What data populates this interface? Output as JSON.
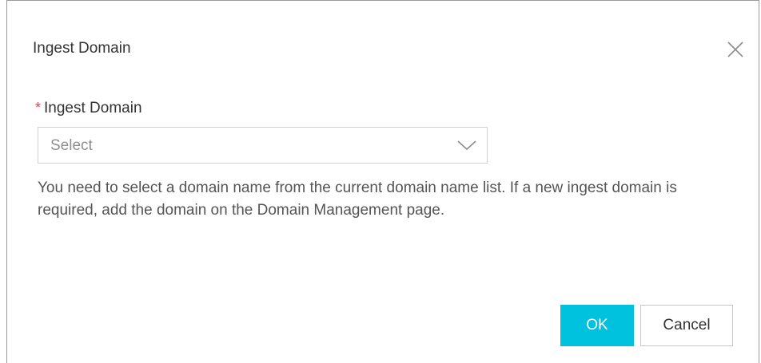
{
  "dialog": {
    "title": "Ingest Domain",
    "close_icon": "close-icon"
  },
  "form": {
    "required_mark": "*",
    "field_label": "Ingest Domain",
    "select": {
      "placeholder": "Select",
      "chevron_icon": "chevron-down-icon"
    },
    "help_text": "You need to select a domain name from the current domain name list. If a new ingest domain is required, add the domain on the Domain Management page."
  },
  "footer": {
    "ok_label": "OK",
    "cancel_label": "Cancel"
  },
  "colors": {
    "accent": "#00c1de",
    "required": "#e5464c"
  }
}
